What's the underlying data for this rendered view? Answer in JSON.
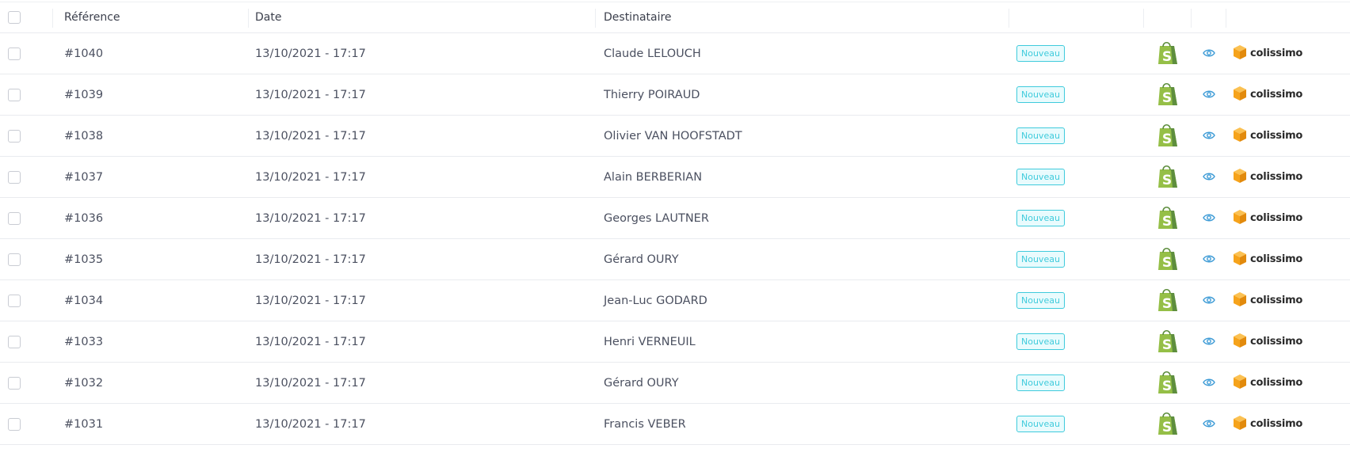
{
  "header": {
    "reference": "Référence",
    "date": "Date",
    "recipient": "Destinataire"
  },
  "rows": [
    {
      "reference": "#1040",
      "date": "13/10/2021 - 17:17",
      "recipient": "Claude LELOUCH",
      "status": "Nouveau",
      "carrier": "colissimo"
    },
    {
      "reference": "#1039",
      "date": "13/10/2021 - 17:17",
      "recipient": "Thierry POIRAUD",
      "status": "Nouveau",
      "carrier": "colissimo"
    },
    {
      "reference": "#1038",
      "date": "13/10/2021 - 17:17",
      "recipient": "Olivier VAN HOOFSTADT",
      "status": "Nouveau",
      "carrier": "colissimo"
    },
    {
      "reference": "#1037",
      "date": "13/10/2021 - 17:17",
      "recipient": "Alain BERBERIAN",
      "status": "Nouveau",
      "carrier": "colissimo"
    },
    {
      "reference": "#1036",
      "date": "13/10/2021 - 17:17",
      "recipient": "Georges LAUTNER",
      "status": "Nouveau",
      "carrier": "colissimo"
    },
    {
      "reference": "#1035",
      "date": "13/10/2021 - 17:17",
      "recipient": "Gérard OURY",
      "status": "Nouveau",
      "carrier": "colissimo"
    },
    {
      "reference": "#1034",
      "date": "13/10/2021 - 17:17",
      "recipient": "Jean-Luc GODARD",
      "status": "Nouveau",
      "carrier": "colissimo"
    },
    {
      "reference": "#1033",
      "date": "13/10/2021 - 17:17",
      "recipient": "Henri VERNEUIL",
      "status": "Nouveau",
      "carrier": "colissimo"
    },
    {
      "reference": "#1032",
      "date": "13/10/2021 - 17:17",
      "recipient": "Gérard OURY",
      "status": "Nouveau",
      "carrier": "colissimo"
    },
    {
      "reference": "#1031",
      "date": "13/10/2021 - 17:17",
      "recipient": "Francis VEBER",
      "status": "Nouveau",
      "carrier": "colissimo"
    }
  ],
  "icons": {
    "source": "shopify-bag-icon",
    "view": "eye-icon",
    "carrier_logo": "colissimo-cube-icon"
  },
  "colors": {
    "status_badge": "#3fcbdc",
    "shopify_green": "#95bf47",
    "view_icon": "#3d9bd6",
    "carrier_orange": "#f6a31b"
  }
}
